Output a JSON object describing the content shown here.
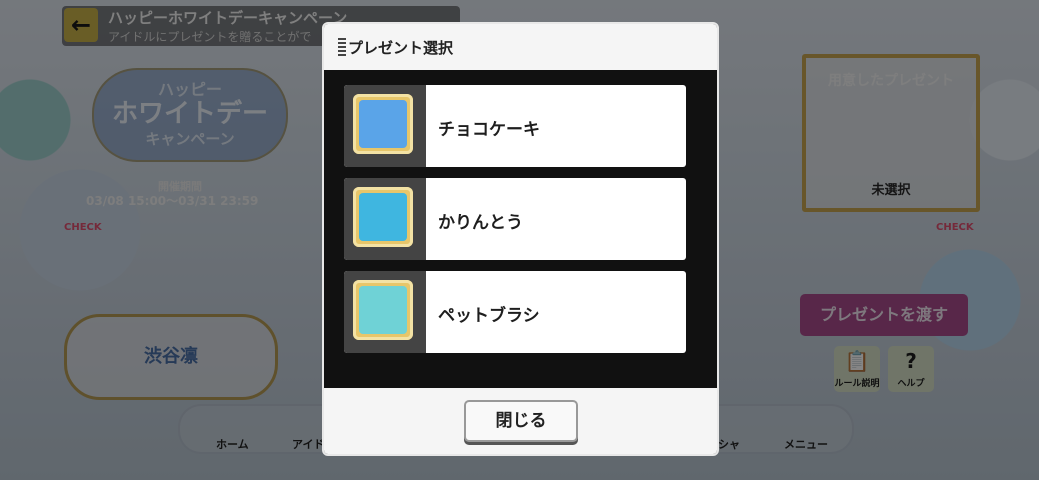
{
  "header": {
    "title": "ハッピーホワイトデーキャンペーン",
    "subtitle": "アイドルにプレゼントを贈ることがで"
  },
  "campaign": {
    "logo_line1": "ハッピー",
    "logo_line2": "ホワイトデー",
    "logo_line3": "キャンペーン",
    "period_label": "開催期間",
    "period": "03/08 15:00〜03/31 23:59",
    "check_left": "CHECK",
    "check_right": "CHECK",
    "idol_name": "渋谷凛"
  },
  "present_panel": {
    "title": "用意したプレゼント",
    "empty_text": "未選択",
    "give_button": "プレゼントを渡す",
    "rules_label": "ルール説明",
    "help_label": "ヘルプ"
  },
  "nav": {
    "home": "ホーム",
    "idol": "アイド",
    "gacha": "シャ",
    "menu": "メニュー"
  },
  "modal": {
    "title": "プレゼント選択",
    "items": [
      {
        "name": "チョコケーキ",
        "color": "#5aa4e8"
      },
      {
        "name": "かりんとう",
        "color": "#3fb6e0"
      },
      {
        "name": "ペットブラシ",
        "color": "#6fd2d6"
      }
    ],
    "close_button": "閉じる"
  },
  "colors": {
    "gold_frame": "#c7a551",
    "give_button": "#a94b8d"
  }
}
